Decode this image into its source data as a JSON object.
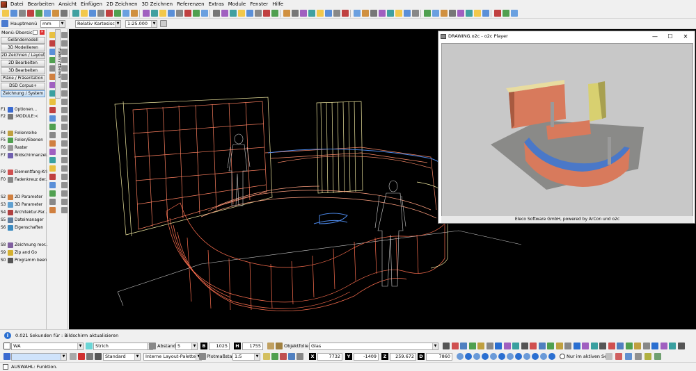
{
  "menu": [
    "Datei",
    "Bearbeiten",
    "Ansicht",
    "Einfügen",
    "2D Zeichnen",
    "3D Zeichnen",
    "Referenzen",
    "Extras",
    "Module",
    "Fenster",
    "Hilfe"
  ],
  "toolbar2": {
    "home_label": "Hauptmenü",
    "unit": "mm",
    "coord_mode": "Relativ Kartesisch",
    "scale": "1:25.000"
  },
  "left_panel": {
    "title": "Menü-Übersicht",
    "buttons": [
      "Geländemodell",
      "3D Modellieren",
      "2D Zeichnen / Layout",
      "2D Bearbeiten",
      "3D Bearbeiten",
      "Pläne / Präsentation",
      "DSD Corpus+",
      "Zeichnung / System"
    ],
    "fkeys": [
      {
        "key": "F1",
        "label": "Optionen..."
      },
      {
        "key": "F2",
        "label": ":MODULE:<"
      },
      {
        "key": "F4",
        "label": "Folienreihe"
      },
      {
        "key": "F5",
        "label": "Folien/Ebenen"
      },
      {
        "key": "F6",
        "label": "Raster"
      },
      {
        "key": "F7",
        "label": "Bildschirmanzei..."
      },
      {
        "key": "F9",
        "label": "Elementfang-Kri..."
      },
      {
        "key": "F0",
        "label": "Fadenkreuz der..."
      },
      {
        "key": "S2",
        "label": "2D Parameter"
      },
      {
        "key": "S3",
        "label": "3D Parameter"
      },
      {
        "key": "S4",
        "label": "Architektur-Par..."
      },
      {
        "key": "S5",
        "label": "Dateimanager"
      },
      {
        "key": "S6",
        "label": "Eigenschaften"
      },
      {
        "key": "S8",
        "label": "Zeichnung reor..."
      },
      {
        "key": "S9",
        "label": "Zip and Go"
      },
      {
        "key": "S0",
        "label": "Programm been..."
      }
    ]
  },
  "vertical_tab": "Folien / Ebenen",
  "player": {
    "title": "DRAWING.o2c - o2c Player",
    "footer": "Eleco Software GmbH, powered by ArCon und o2c"
  },
  "status": {
    "message": "0.021 Sekunden für : Bildschirm aktualisieren"
  },
  "props_bar": {
    "layer": "WA",
    "line_style": "Strich",
    "distance_label": "Abstand",
    "distance_value": "5",
    "b_value": "1025",
    "h_value": "1755",
    "foil_label": "Objektfolie",
    "material": "Glas"
  },
  "coord_bar": {
    "pen": "Standard",
    "palette": "Interne Layout-Palette",
    "plot_scale_label": "Plotmaßstab",
    "plot_scale": "1:5",
    "x": "7732",
    "y": "-1409",
    "z": "259.672",
    "d": "7860",
    "active_set": "Nur im aktiven Set"
  },
  "bottom": {
    "prompt": "AUSWAHL: Funktion."
  }
}
